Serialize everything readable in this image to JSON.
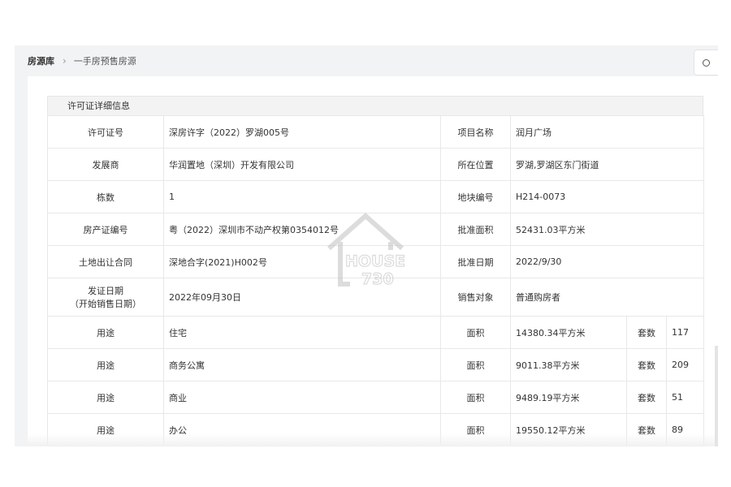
{
  "breadcrumb": {
    "root": "房源库",
    "separator": "›",
    "current": "一手房预售房源"
  },
  "section_title": "许可证详细信息",
  "info_rows": [
    {
      "l1": "许可证号",
      "v1": "深房许字（2022）罗湖005号",
      "l2": "项目名称",
      "v2": "润月广场"
    },
    {
      "l1": "发展商",
      "v1": "华润置地（深圳）开发有限公司",
      "l2": "所在位置",
      "v2": "罗湖,罗湖区东门街道"
    },
    {
      "l1": "栋数",
      "v1": "1",
      "l2": "地块编号",
      "v2": "H214-0073"
    },
    {
      "l1": "房产证编号",
      "v1": "粤（2022）深圳市不动产权第0354012号",
      "l2": "批准面积",
      "v2": "52431.03平方米"
    },
    {
      "l1": "土地出让合同",
      "v1": "深地合字(2021)H002号",
      "l2": "批准日期",
      "v2": "2022/9/30"
    },
    {
      "l1a": "发证日期",
      "l1b": "（开始销售日期）",
      "v1": "2022年09月30日",
      "l2": "销售对象",
      "v2": "普通购房者"
    }
  ],
  "usage_rows": [
    {
      "label": "用途",
      "type": "住宅",
      "area_label": "面积",
      "area": "14380.34平方米",
      "units_label": "套数",
      "units": "117"
    },
    {
      "label": "用途",
      "type": "商务公寓",
      "area_label": "面积",
      "area": "9011.38平方米",
      "units_label": "套数",
      "units": "209"
    },
    {
      "label": "用途",
      "type": "商业",
      "area_label": "面积",
      "area": "9489.19平方米",
      "units_label": "套数",
      "units": "51"
    },
    {
      "label": "用途",
      "type": "办公",
      "area_label": "面积",
      "area": "19550.12平方米",
      "units_label": "套数",
      "units": "89"
    }
  ],
  "watermark": {
    "line1": "HOUSE",
    "line2": "730",
    "icon": "house-outline-icon"
  },
  "colors": {
    "app_bg": "#f2f3f5",
    "header_bg": "#f3f3f3",
    "border": "#e8e8e8",
    "text": "#333333"
  }
}
